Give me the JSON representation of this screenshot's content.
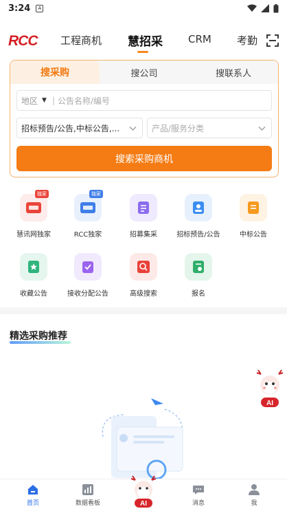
{
  "status_bar": {
    "time": "3:24",
    "notif_glyph": "A"
  },
  "top_nav": {
    "logo": "RCC",
    "tabs": [
      {
        "label": "工程商机",
        "active": false
      },
      {
        "label": "慧招采",
        "active": true
      },
      {
        "label": "CRM",
        "active": false
      },
      {
        "label": "考勤",
        "active": false
      }
    ]
  },
  "search": {
    "tabs": [
      {
        "label": "搜采购",
        "active": true
      },
      {
        "label": "搜公司",
        "active": false
      },
      {
        "label": "搜联系人",
        "active": false
      }
    ],
    "region_label": "地区",
    "region_caret": "▼",
    "keyword_placeholder": "公告名称/编号",
    "type_value": "招标预告/公告,中标公告,...",
    "category_placeholder": "产品/服务分类",
    "button_label": "搜索采购商机"
  },
  "grid": [
    {
      "label": "慧讯网独家",
      "icon": "icc-exclusive-icon",
      "badge": "独家",
      "color": "#e9443a"
    },
    {
      "label": "RCC独家",
      "icon": "rcc-exclusive-icon",
      "badge": "独家",
      "color": "#3f7ee8"
    },
    {
      "label": "招募集采",
      "icon": "recruit-procure-icon",
      "badge": "",
      "color": "#8b6cf0"
    },
    {
      "label": "招标预告/公告",
      "icon": "tender-notice-icon",
      "badge": "",
      "color": "#3b8ef0"
    },
    {
      "label": "中标公告",
      "icon": "award-notice-icon",
      "badge": "",
      "color": "#f59a1f"
    },
    {
      "label": "收藏公告",
      "icon": "favorite-notice-icon",
      "badge": "",
      "color": "#2fb47d"
    },
    {
      "label": "接收分配公告",
      "icon": "assigned-notice-icon",
      "badge": "",
      "color": "#9a63ef"
    },
    {
      "label": "高级搜索",
      "icon": "advanced-search-icon",
      "badge": "",
      "color": "#e8423a"
    },
    {
      "label": "报名",
      "icon": "signup-icon",
      "badge": "",
      "color": "#2fae6a"
    }
  ],
  "section": {
    "title": "精选采购推荐"
  },
  "bottom_nav": {
    "items": [
      {
        "label": "首页",
        "icon": "home-icon",
        "active": true
      },
      {
        "label": "数据看板",
        "icon": "chart-icon",
        "active": false
      },
      {
        "label": "AI",
        "icon": "ai-mascot-icon",
        "active": false
      },
      {
        "label": "消息",
        "icon": "message-icon",
        "active": false
      },
      {
        "label": "我",
        "icon": "profile-icon",
        "active": false
      }
    ]
  },
  "colors": {
    "accent": "#f57c14",
    "brand_red": "#d61f26",
    "active_blue": "#2c6ee6"
  }
}
